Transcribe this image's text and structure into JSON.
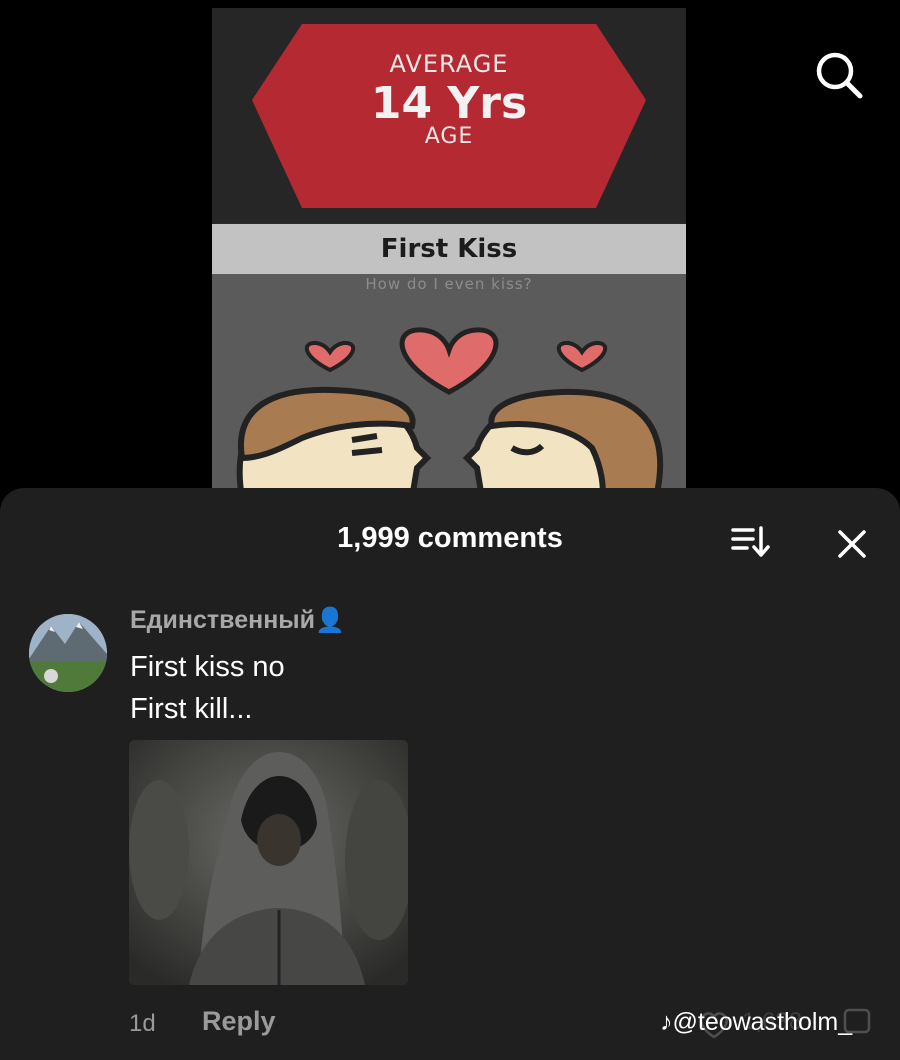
{
  "video": {
    "badge_top": "AVERAGE",
    "badge_value": "14 Yrs",
    "badge_bottom": "AGE",
    "title": "First Kiss",
    "subtitle": "How do I even kiss?"
  },
  "colors": {
    "hexagon": "#b52a32",
    "heart": "#e06b6b",
    "face": "#f2e3c2",
    "hair": "#a87b50",
    "sheet_bg": "#1f1f1f"
  },
  "icons": {
    "search": "search-icon",
    "sort": "sort-icon",
    "close": "close-icon",
    "heart": "heart-icon",
    "tiktok": "tiktok-icon"
  },
  "comments_panel": {
    "title": "1,999 comments",
    "comment": {
      "username": "Единственный",
      "username_emoji": "👤",
      "text_line1": "First kiss no",
      "text_line2": "First kill...",
      "time": "1d",
      "reply_label": "Reply",
      "like_count": "1,638"
    }
  },
  "watermark": {
    "icon_glyph": "♪",
    "handle": "@teowastholm_"
  }
}
